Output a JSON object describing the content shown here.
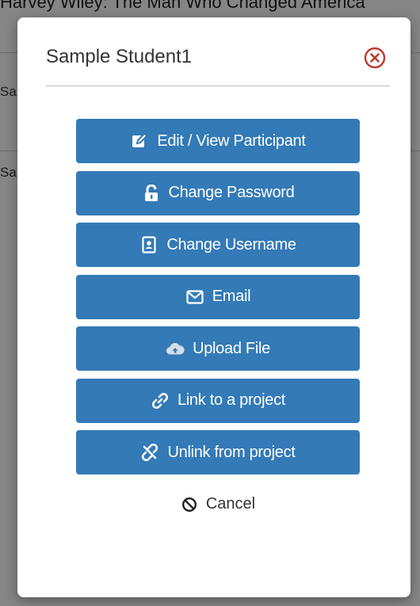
{
  "background": {
    "title": "Harvey Wiley: The Man Who Changed America",
    "side_text_1": "Sa",
    "side_text_2": "Sa"
  },
  "modal": {
    "title": "Sample Student1",
    "close_icon": "close-circle-icon",
    "buttons": [
      {
        "label": "Edit / View Participant",
        "icon": "edit-icon"
      },
      {
        "label": "Change Password",
        "icon": "unlock-icon"
      },
      {
        "label": "Change Username",
        "icon": "id-card-icon"
      },
      {
        "label": "Email",
        "icon": "envelope-icon"
      },
      {
        "label": "Upload File",
        "icon": "cloud-upload-icon"
      },
      {
        "label": "Link to a project",
        "icon": "link-icon"
      },
      {
        "label": "Unlink from project",
        "icon": "unlink-icon"
      }
    ],
    "cancel_label": "Cancel",
    "cancel_icon": "ban-icon"
  },
  "colors": {
    "primary_button": "#337ab7",
    "close_icon": "#c0392b"
  }
}
